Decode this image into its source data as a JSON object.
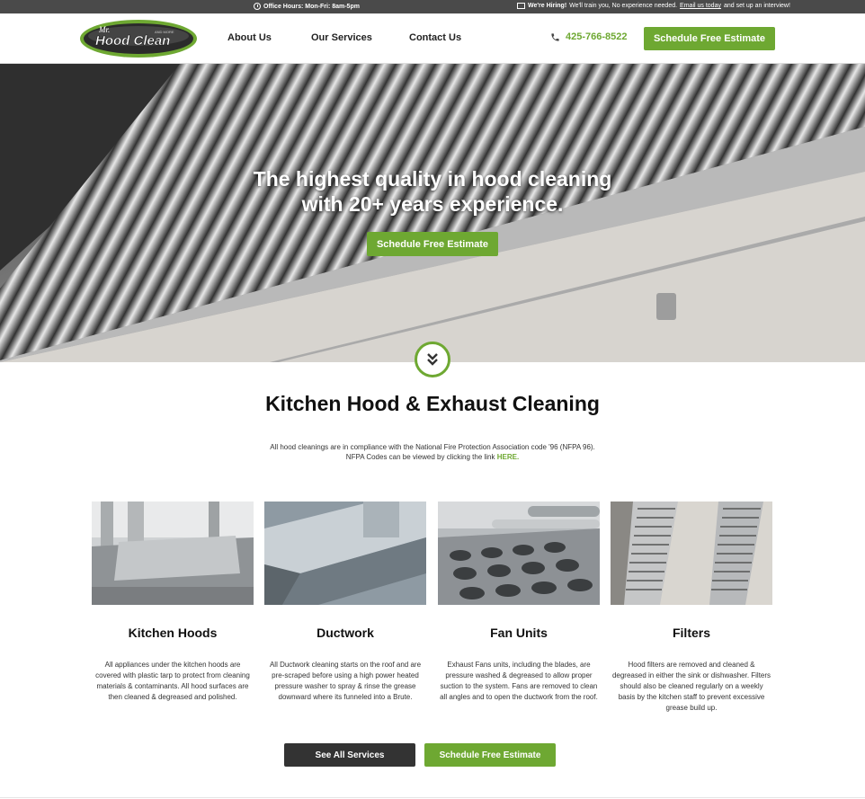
{
  "topbar": {
    "hours": "Office Hours: Mon-Fri: 8am-5pm",
    "hiring_bold": "We're Hiring!",
    "hiring_text": "We'll train you, No experience needed.",
    "hiring_link": "Email us today",
    "hiring_tail": "and set up an interview!"
  },
  "logo": {
    "small": "Mr.",
    "name": "Hood Clean",
    "tag": "AND MORE"
  },
  "nav": {
    "about": "About Us",
    "services": "Our Services",
    "contact": "Contact Us"
  },
  "phone": "425-766-8522",
  "cta_label": "Schedule Free Estimate",
  "hero": {
    "line1": "The highest quality in hood cleaning",
    "line2": "with 20+ years experience."
  },
  "section": {
    "title": "Kitchen Hood & Exhaust Cleaning",
    "desc_line1": "All hood cleanings are in compliance with the National Fire Protection Association code '96 (NFPA 96).",
    "desc_line2": "NFPA Codes can be viewed by clicking the link",
    "desc_link": "HERE."
  },
  "cards": [
    {
      "title": "Kitchen Hoods",
      "text": "All appliances under the kitchen hoods are covered with plastic tarp to protect from cleaning materials & contaminants. All hood surfaces are then cleaned & degreased and polished."
    },
    {
      "title": "Ductwork",
      "text": "All Ductwork cleaning starts on the roof and are pre-scraped before using a high power heated pressure washer to spray & rinse the grease downward where its funneled into a Brute."
    },
    {
      "title": "Fan Units",
      "text": "Exhaust Fans units, including the blades, are pressure washed & degreased to allow proper suction to the system. Fans are removed to clean all angles and to open the ductwork from the roof."
    },
    {
      "title": "Filters",
      "text": "Hood filters are removed and cleaned & degreased in either the sink or dishwasher. Filters should also be cleaned regularly on a weekly basis by the kitchen staff to prevent excessive grease build up."
    }
  ],
  "buttons": {
    "see_all": "See All Services"
  },
  "colors": {
    "accent": "#6ea832",
    "topbar": "#4a4a4a",
    "dark_button": "#333333"
  },
  "icons": [
    "clock-icon",
    "mail-icon",
    "phone-icon",
    "chevron-double-down-icon"
  ]
}
